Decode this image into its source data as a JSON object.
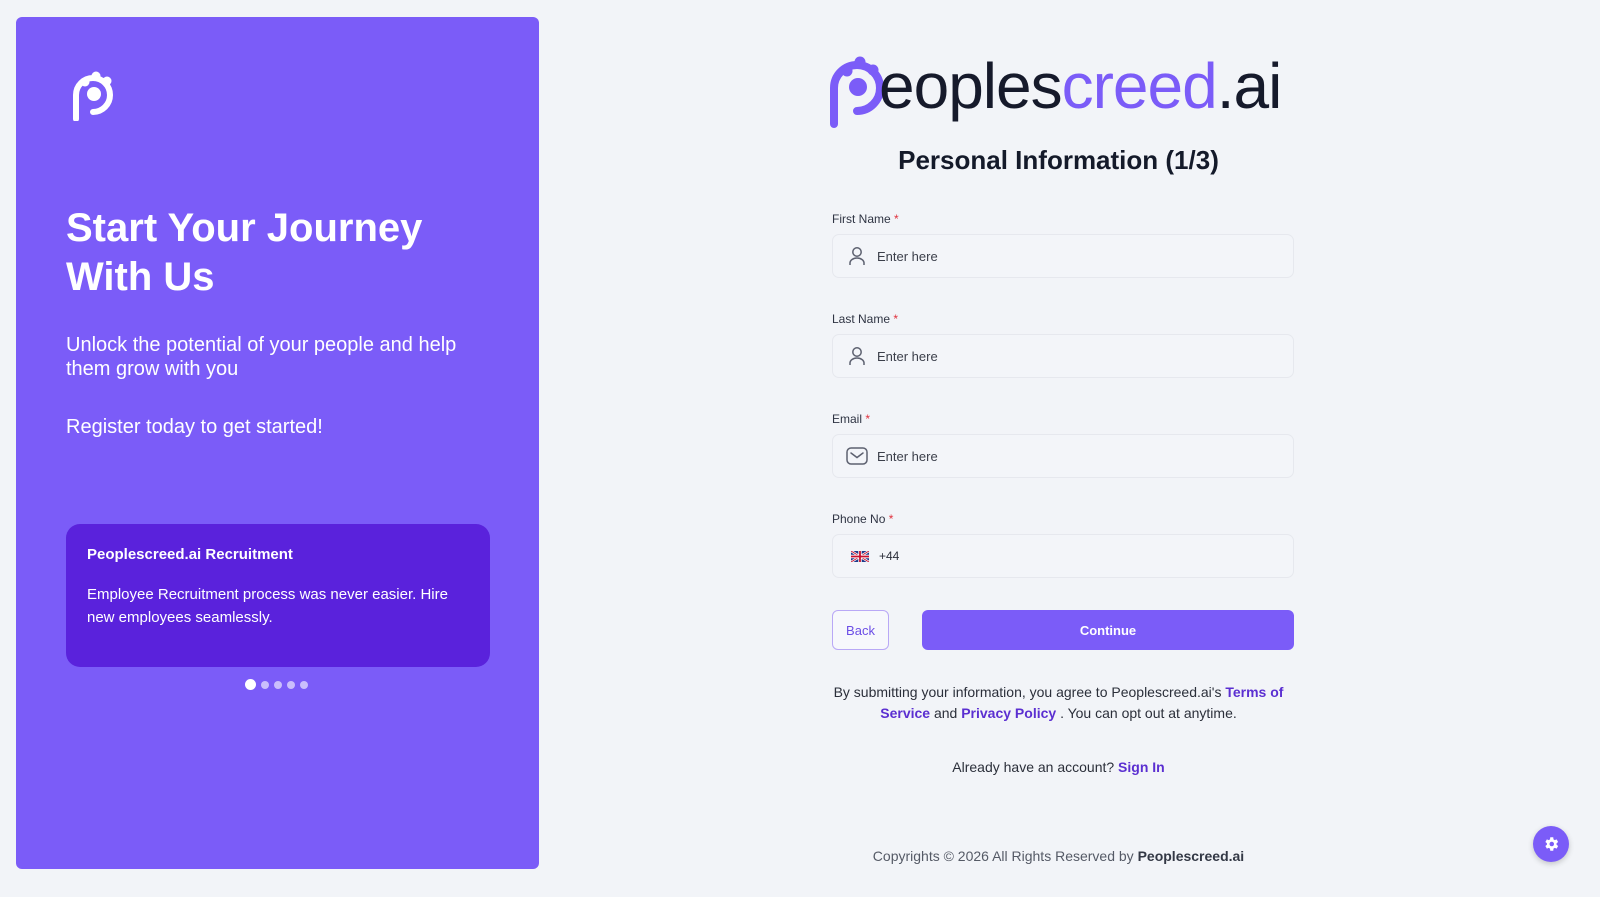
{
  "left_panel": {
    "hero_title": "Start Your Journey With Us",
    "hero_subtitle": "Unlock the potential of your people and help them grow with you",
    "hero_cta": "Register today to get started!",
    "carousel": {
      "slide_title": "Peoplescreed.ai Recruitment",
      "slide_text": "Employee Recruitment process was never easier. Hire new employees seamlessly.",
      "active_index": 0,
      "count": 5
    }
  },
  "brand": {
    "logo_text_dark": "eoples",
    "logo_text_purple": "creed",
    "logo_text_suffix": ".ai",
    "accent": "#7b5cf8"
  },
  "form": {
    "title": "Personal Information (1/3)",
    "required_marker": "*",
    "first_name": {
      "label": "First Name",
      "placeholder": "Enter here",
      "icon": "user-icon"
    },
    "last_name": {
      "label": "Last Name",
      "placeholder": "Enter here",
      "icon": "user-icon"
    },
    "email": {
      "label": "Email",
      "placeholder": "Enter here",
      "icon": "mail-icon"
    },
    "phone": {
      "label": "Phone No",
      "dial_code": "+44",
      "flag": "uk-flag-icon"
    },
    "back_label": "Back",
    "continue_label": "Continue"
  },
  "consent": {
    "prefix": "By submitting your information, you agree to Peoplescreed.ai's",
    "terms_link": "Terms of Service",
    "and": "and",
    "privacy_link": "Privacy Policy",
    "suffix": ". You can opt out at anytime."
  },
  "signin": {
    "prompt": "Already have an account?",
    "link": "Sign In"
  },
  "footer": {
    "copyright_prefix": "Copyrights © 2026 All Rights Reserved by",
    "copyright_brand": "Peoplescreed.ai"
  },
  "settings": {
    "icon": "gear-icon"
  }
}
